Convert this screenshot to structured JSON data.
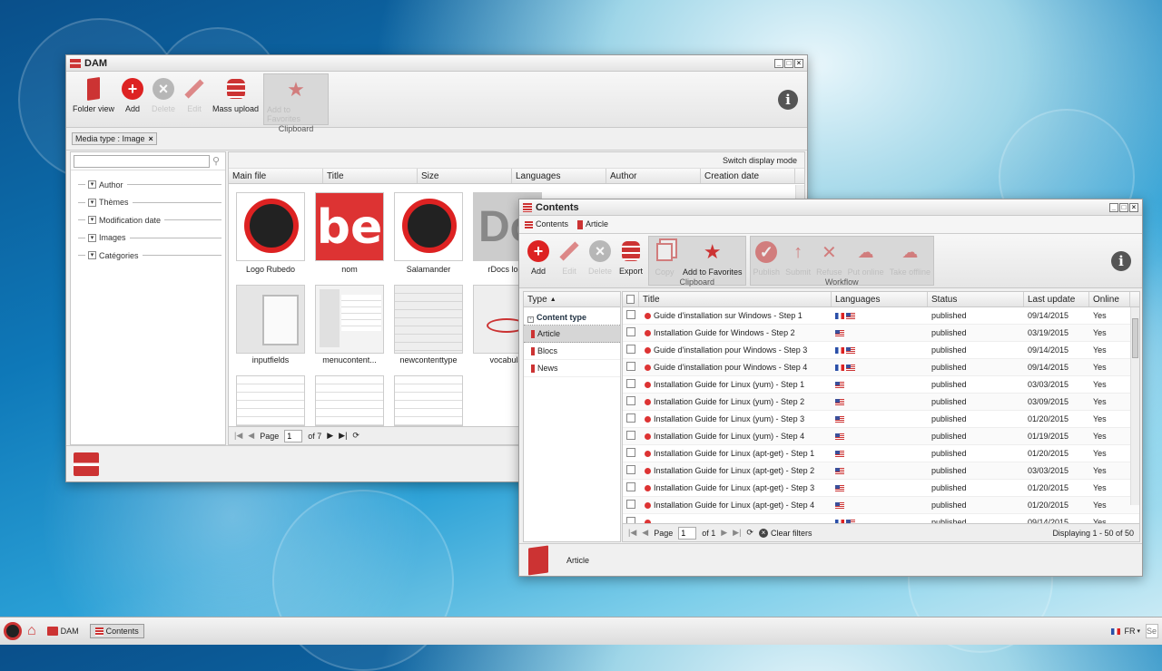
{
  "dam_window": {
    "title": "DAM",
    "toolbar": {
      "folder_view": "Folder view",
      "add": "Add",
      "delete": "Delete",
      "edit": "Edit",
      "mass_upload": "Mass upload",
      "add_to_favorites": "Add to Favorites",
      "clipboard_label": "Clipboard"
    },
    "filter_tag": "Media type : Image",
    "search_placeholder": "",
    "facets": [
      "Author",
      "Thèmes",
      "Modification date",
      "Images",
      "Catégories"
    ],
    "switch_display_mode": "Switch display mode",
    "columns": [
      "Main file",
      "Title",
      "Size",
      "Languages",
      "Author",
      "Creation date"
    ],
    "thumbnails": [
      {
        "caption": "Logo Rubedo",
        "icon": "salamander-logo"
      },
      {
        "caption": "nom",
        "icon": "be-text"
      },
      {
        "caption": "Salamander",
        "icon": "salamander-logo"
      },
      {
        "caption": "rDocs logo",
        "icon": "docs-text"
      },
      {
        "caption": "inputfields",
        "icon": "ui-screenshot"
      },
      {
        "caption": "menucontent...",
        "icon": "ui-screenshot"
      },
      {
        "caption": "newcontenttype",
        "icon": "ui-screenshot"
      },
      {
        "caption": "vocabular",
        "icon": "difficulty-image"
      },
      {
        "caption": "",
        "icon": "ui-screenshot"
      },
      {
        "caption": "",
        "icon": "ui-screenshot"
      },
      {
        "caption": "",
        "icon": "ui-screenshot"
      }
    ],
    "pager": {
      "page_label": "Page",
      "page_value": "1",
      "of_label": "of 7"
    }
  },
  "contents_window": {
    "title": "Contents",
    "breadcrumb": [
      "Contents",
      "Article"
    ],
    "toolbar": {
      "add": "Add",
      "edit": "Edit",
      "delete": "Delete",
      "export": "Export",
      "copy": "Copy",
      "add_to_favorites": "Add to Favorites",
      "clipboard_label": "Clipboard",
      "publish": "Publish",
      "submit": "Submit",
      "refuse": "Refuse",
      "put_online": "Put online",
      "take_offline": "Take offline",
      "workflow_label": "Workflow"
    },
    "type_header": "Type",
    "content_type_label": "Content type",
    "types": [
      "Article",
      "Blocs",
      "News"
    ],
    "columns": [
      "Title",
      "Languages",
      "Status",
      "Last update",
      "Online"
    ],
    "rows": [
      {
        "title": "Guide d'installation sur Windows - Step 1",
        "langs": [
          "fr",
          "us"
        ],
        "status": "published",
        "updated": "09/14/2015",
        "online": "Yes"
      },
      {
        "title": "Installation Guide for Windows - Step 2",
        "langs": [
          "us"
        ],
        "status": "published",
        "updated": "03/19/2015",
        "online": "Yes"
      },
      {
        "title": "Guide d'installation pour Windows - Step 3",
        "langs": [
          "fr",
          "us"
        ],
        "status": "published",
        "updated": "09/14/2015",
        "online": "Yes"
      },
      {
        "title": "Guide d'installation pour Windows - Step 4",
        "langs": [
          "fr",
          "us"
        ],
        "status": "published",
        "updated": "09/14/2015",
        "online": "Yes"
      },
      {
        "title": "Installation Guide for Linux (yum) - Step 1",
        "langs": [
          "us"
        ],
        "status": "published",
        "updated": "03/03/2015",
        "online": "Yes"
      },
      {
        "title": "Installation Guide for Linux (yum) - Step 2",
        "langs": [
          "us"
        ],
        "status": "published",
        "updated": "03/09/2015",
        "online": "Yes"
      },
      {
        "title": "Installation Guide for Linux (yum) - Step 3",
        "langs": [
          "us"
        ],
        "status": "published",
        "updated": "01/20/2015",
        "online": "Yes"
      },
      {
        "title": "Installation Guide for Linux (yum) - Step 4",
        "langs": [
          "us"
        ],
        "status": "published",
        "updated": "01/19/2015",
        "online": "Yes"
      },
      {
        "title": "Installation Guide for Linux (apt-get) - Step 1",
        "langs": [
          "us"
        ],
        "status": "published",
        "updated": "01/20/2015",
        "online": "Yes"
      },
      {
        "title": "Installation Guide for Linux (apt-get) - Step 2",
        "langs": [
          "us"
        ],
        "status": "published",
        "updated": "03/03/2015",
        "online": "Yes"
      },
      {
        "title": "Installation Guide for Linux (apt-get) - Step 3",
        "langs": [
          "us"
        ],
        "status": "published",
        "updated": "01/20/2015",
        "online": "Yes"
      },
      {
        "title": "Installation Guide for Linux (apt-get) - Step 4",
        "langs": [
          "us"
        ],
        "status": "published",
        "updated": "01/20/2015",
        "online": "Yes"
      },
      {
        "title": "",
        "langs": [
          "fr",
          "us"
        ],
        "status": "published",
        "updated": "09/14/2015",
        "online": "Yes"
      }
    ],
    "pager": {
      "page_label": "Page",
      "page_value": "1",
      "of_label": "of 1",
      "clear_filters": "Clear filters",
      "displaying": "Displaying 1 - 50 of 50"
    },
    "footer_label": "Article"
  },
  "taskbar": {
    "items": [
      "DAM",
      "Contents"
    ],
    "lang": "FR",
    "search_placeholder": "Se"
  }
}
